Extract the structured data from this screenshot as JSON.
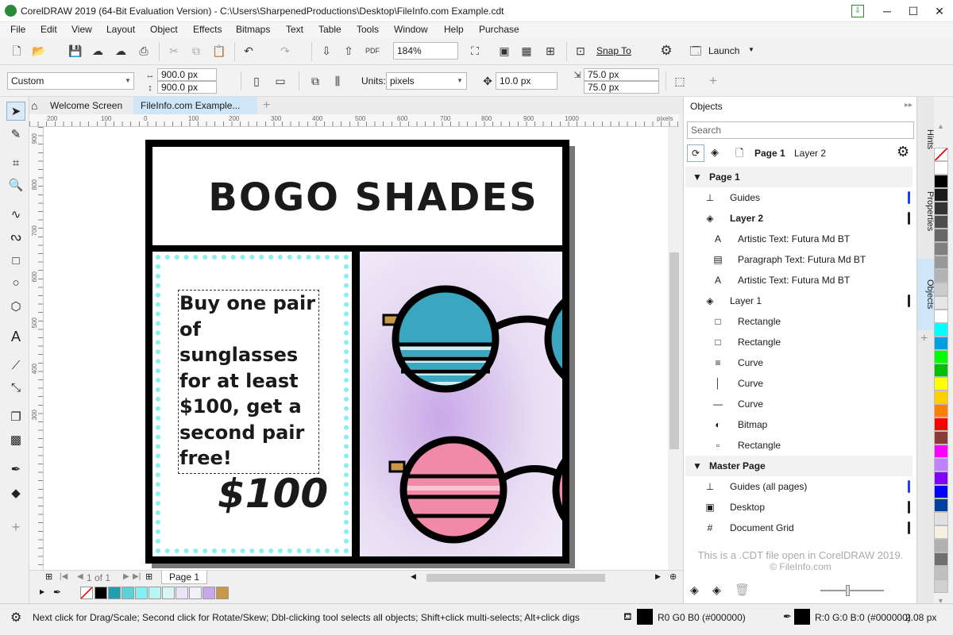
{
  "window": {
    "title": "CorelDRAW 2019 (64-Bit Evaluation Version) - C:\\Users\\SharpenedProductions\\Desktop\\FileInfo.com Example.cdt",
    "minimize": "─",
    "maximize": "☐",
    "close": "✕"
  },
  "menubar": [
    "File",
    "Edit",
    "View",
    "Layout",
    "Object",
    "Effects",
    "Bitmaps",
    "Text",
    "Table",
    "Tools",
    "Window",
    "Help",
    "Purchase"
  ],
  "toolbar": {
    "zoom": "184%",
    "snap_to": "Snap To",
    "launch": "Launch"
  },
  "propbar": {
    "preset": "Custom",
    "width": "900.0 px",
    "height": "900.0 px",
    "units_label": "Units:",
    "units": "pixels",
    "nudge": "10.0 px",
    "dup_x": "75.0 px",
    "dup_y": "75.0 px"
  },
  "doc_tabs": {
    "welcome": "Welcome Screen",
    "active": "FileInfo.com Example...",
    "add": "+"
  },
  "ruler": {
    "h_labels": [
      "200",
      "100",
      "0",
      "100",
      "200",
      "300",
      "400",
      "500",
      "600",
      "700",
      "800",
      "900",
      "1000"
    ],
    "unit": "pixels",
    "v_labels": [
      "900",
      "800",
      "700",
      "600",
      "500",
      "400",
      "300"
    ]
  },
  "design": {
    "headline": "BOGO SHADES",
    "promo_text": "Buy one pair of sunglasses for at least $100, get a second pair free!",
    "price": "$100",
    "colors": {
      "border": "#000000",
      "dots": "#86f0f0",
      "lens_blue": "#3aa6c0",
      "lens_pink": "#f08aa8",
      "bg_lavender": "#e8dcf3"
    }
  },
  "pagebar": {
    "page_count": "1 of 1",
    "page_tab": "Page 1"
  },
  "document_palette": [
    "#000000",
    "#1f9fb0",
    "#5fcfd8",
    "#86f0f0",
    "#b8f6f6",
    "#d9f5f5",
    "#e9e4f6",
    "#f4f0fb",
    "#c8a8e8",
    "#c89848"
  ],
  "status": {
    "hint": "Next click for Drag/Scale; Second click for Rotate/Skew; Dbl-clicking tool selects all objects; Shift+click multi-selects; Alt+click digs",
    "fill": "R0 G0 B0 (#000000)",
    "outline": "R:0 G:0 B:0 (#000000)",
    "outline_width": "2.08 px"
  },
  "objects_panel": {
    "title": "Objects",
    "search_placeholder": "Search",
    "current_page": "Page 1",
    "current_layer": "Layer 2",
    "rows": [
      {
        "label": "Page 1",
        "level": 0,
        "bold": true,
        "icon": "▼"
      },
      {
        "label": "Guides",
        "level": 1,
        "icon": "⊥"
      },
      {
        "label": "Layer 2",
        "level": 1,
        "bold": true,
        "icon": "◈"
      },
      {
        "label": "Artistic Text: Futura Md BT",
        "level": 2,
        "icon": "A"
      },
      {
        "label": "Paragraph Text: Futura Md BT",
        "level": 2,
        "icon": "▤"
      },
      {
        "label": "Artistic Text: Futura Md BT",
        "level": 2,
        "icon": "A"
      },
      {
        "label": "Layer 1",
        "level": 1,
        "icon": "◈"
      },
      {
        "label": "Rectangle",
        "level": 2,
        "icon": "□"
      },
      {
        "label": "Rectangle",
        "level": 2,
        "icon": "□"
      },
      {
        "label": "Curve",
        "level": 2,
        "icon": "≡"
      },
      {
        "label": "Curve",
        "level": 2,
        "icon": "│"
      },
      {
        "label": "Curve",
        "level": 2,
        "icon": "—"
      },
      {
        "label": "Bitmap",
        "level": 2,
        "icon": "◐"
      },
      {
        "label": "Rectangle",
        "level": 2,
        "icon": "▫"
      },
      {
        "label": "Master Page",
        "level": 0,
        "bold": true,
        "icon": "▼"
      },
      {
        "label": "Guides (all pages)",
        "level": 1,
        "icon": "⊥"
      },
      {
        "label": "Desktop",
        "level": 1,
        "icon": "▣"
      },
      {
        "label": "Document Grid",
        "level": 1,
        "icon": "#"
      }
    ],
    "watermark_line1": "This is a .CDT file open in CorelDRAW 2019.",
    "watermark_line2": "© FileInfo.com"
  },
  "side_tabs": [
    "Hints",
    "Properties",
    "Objects"
  ],
  "color_palette": [
    "#ffffff",
    "#000000",
    "#1a1a1a",
    "#333333",
    "#4d4d4d",
    "#666666",
    "#808080",
    "#999999",
    "#b3b3b3",
    "#cccccc",
    "#e6e6e6",
    "#ffffff",
    "#00ffff",
    "#00a0e0",
    "#00ff00",
    "#00c000",
    "#ffff00",
    "#ffd000",
    "#ff8000",
    "#ff0000",
    "#8b3a3a",
    "#ff00ff",
    "#c080ff",
    "#8000ff",
    "#0000ff",
    "#0040a0",
    "#e0e0e0",
    "#f5f0e0",
    "#b0b0b0",
    "#707070",
    "#c0c0c0",
    "#d0d0d0",
    "#a0a0a0"
  ]
}
